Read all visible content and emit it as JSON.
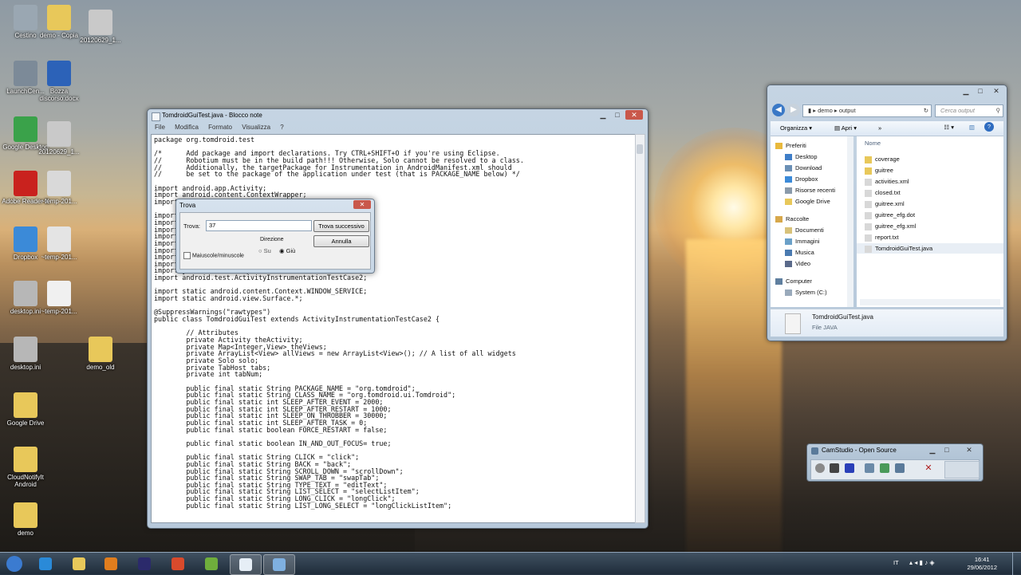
{
  "desktop": {
    "icons": [
      {
        "label": "Cestino",
        "color": "#9aa7b2"
      },
      {
        "label": "demo - Copia",
        "color": "#e8c85a"
      },
      {
        "label": "20120629_1...",
        "color": "#c9c9c9"
      },
      {
        "label": "LaunchCen...",
        "color": "#7c8a98"
      },
      {
        "label": "Bozza discorso.docx",
        "color": "#2c62b8"
      },
      {
        "label": "Google Desktop",
        "color": "#3aa24a"
      },
      {
        "label": "20120629_1...",
        "color": "#c9c9c9"
      },
      {
        "label": "Adobe Reader X",
        "color": "#c9221e"
      },
      {
        "label": "~temp-201...",
        "color": "#d9d9d9"
      },
      {
        "label": "Dropbox",
        "color": "#3b8ad8"
      },
      {
        "label": "~temp-201...",
        "color": "#e4e4e4"
      },
      {
        "label": "desktop.ini",
        "color": "#b7b7b7"
      },
      {
        "label": "~temp-201...",
        "color": "#f0f0f0"
      },
      {
        "label": "desktop.ini",
        "color": "#b7b7b7"
      },
      {
        "label": "demo_old",
        "color": "#e8c85a"
      },
      {
        "label": "Google Drive",
        "color": "#e8c85a"
      },
      {
        "label": "CloudNotifyIt Android",
        "color": "#e8c85a"
      },
      {
        "label": "demo",
        "color": "#e8c85a"
      }
    ]
  },
  "notepad": {
    "title": "TomdroidGuiTest.java - Blocco note",
    "menu": [
      "File",
      "Modifica",
      "Formato",
      "Visualizza",
      "?"
    ],
    "controls": {
      "minimize": "▁",
      "maximize": "□",
      "close": "✕"
    },
    "lines": [
      "package org.tomdroid.test",
      "",
      "/*      Add package and import declarations. Try CTRL+SHIFT+O if you're using Eclipse.",
      "//      Robotium must be in the build path!!! Otherwise, Solo cannot be resolved to a class.",
      "//      Additionally, the targetPackage for Instrumentation in AndroidManifest.xml should",
      "//      be set to the package of the application under test (that is PACKAGE_NAME below) */",
      "",
      "import android.app.Activity;",
      "import android.content.ContextWrapper;",
      "import",
      "",
      "import",
      "import",
      "import",
      "import",
      "import",
      "import",
      "import",
      "import",
      "import java.util.HashMap;",
      "import android.test.ActivityInstrumentationTestCase2;",
      "",
      "import static android.content.Context.WINDOW_SERVICE;",
      "import static android.view.Surface.*;",
      "",
      "@SuppressWarnings(\"rawtypes\")",
      "public class TomdroidGuiTest extends ActivityInstrumentationTestCase2 {",
      "",
      "        // Attributes",
      "        private Activity theActivity;",
      "        private Map<Integer,View> theViews;",
      "        private ArrayList<View> allViews = new ArrayList<View>(); // A list of all widgets",
      "        private Solo solo;",
      "        private TabHost tabs;",
      "        private int tabNum;",
      "",
      "        public final static String PACKAGE_NAME = \"org.tomdroid\";",
      "        public final static String CLASS_NAME = \"org.tomdroid.ui.Tomdroid\";",
      "        public final static int SLEEP_AFTER_EVENT = 2000;",
      "        public final static int SLEEP_AFTER_RESTART = 1000;",
      "        public final static int SLEEP_ON_THROBBER = 30000;",
      "        public final static int SLEEP_AFTER_TASK = 0;",
      "        public final static boolean FORCE_RESTART = false;",
      "",
      "        public final static boolean IN_AND_OUT_FOCUS= true;",
      "",
      "        public final static String CLICK = \"click\";",
      "        public final static String BACK = \"back\";",
      "        public final static String SCROLL_DOWN = \"scrollDown\";",
      "        public final static String SWAP_TAB = \"swapTab\";",
      "        public final static String TYPE_TEXT = \"editText\";",
      "        public final static String LIST_SELECT = \"selectListItem\";",
      "        public final static String LONG_CLICK = \"longClick\";",
      "        public final static String LIST_LONG_SELECT = \"longClickListItem\";"
    ]
  },
  "find_dialog": {
    "title": "Trova",
    "close": "✕",
    "find_label": "Trova:",
    "find_value": "37",
    "find_next": "Trova successivo",
    "cancel": "Annulla",
    "direction_label": "Direzione",
    "direction_up": "Su",
    "direction_down": "Giù",
    "match_case": "Maiuscole/minuscole"
  },
  "explorer": {
    "controls": {
      "minimize": "▁",
      "maximize": "□",
      "close": "✕"
    },
    "breadcrumb": [
      "demo",
      "output"
    ],
    "search_placeholder": "Cerca output",
    "toolbar": {
      "organize": "Organizza",
      "open": "Apri",
      "more": "»"
    },
    "column_name": "Nome",
    "nav": {
      "favorites": "Preferiti",
      "favorites_items": [
        "Desktop",
        "Download",
        "Dropbox",
        "Risorse recenti",
        "Google Drive"
      ],
      "libraries": "Raccolte",
      "libraries_items": [
        "Documenti",
        "Immagini",
        "Musica",
        "Video"
      ],
      "computer": "Computer",
      "computer_items": [
        "System (C:)"
      ]
    },
    "files": [
      {
        "name": "coverage",
        "color": "#e8c85a"
      },
      {
        "name": "guitree",
        "color": "#e8c85a"
      },
      {
        "name": "activities.xml",
        "color": "#d8d8d8"
      },
      {
        "name": "closed.txt",
        "color": "#d8d8d8"
      },
      {
        "name": "guitree.xml",
        "color": "#d8d8d8"
      },
      {
        "name": "guitree_efg.dot",
        "color": "#d8d8d8"
      },
      {
        "name": "guitree_efg.xml",
        "color": "#d8d8d8"
      },
      {
        "name": "report.txt",
        "color": "#d8d8d8"
      },
      {
        "name": "TomdroidGuiTest.java",
        "color": "#d8d8d8"
      }
    ],
    "details": {
      "name": "TomdroidGuiTest.java",
      "type": "File JAVA"
    }
  },
  "camstudio": {
    "title": "CamStudio - Open Source",
    "controls": {
      "minimize": "▁",
      "maximize": "□",
      "close": "✕"
    }
  },
  "taskbar": {
    "items": [
      {
        "name": "start-button",
        "color": "#3b7bd0"
      },
      {
        "name": "internet-explorer-icon",
        "color": "#2a8ad8"
      },
      {
        "name": "explorer-folder-icon",
        "color": "#e8c85a"
      },
      {
        "name": "media-player-icon",
        "color": "#e07d1e"
      },
      {
        "name": "eclipse-icon",
        "color": "#2b2a6b"
      },
      {
        "name": "chrome-icon",
        "color": "#d84a2c"
      },
      {
        "name": "launch-center-icon",
        "color": "#6fae3c"
      },
      {
        "name": "notepad-icon",
        "color": "#e6eef6"
      },
      {
        "name": "camstudio-icon",
        "color": "#7fb0e0"
      }
    ],
    "lang": "IT",
    "time": "16:41",
    "date": "29/06/2012"
  }
}
